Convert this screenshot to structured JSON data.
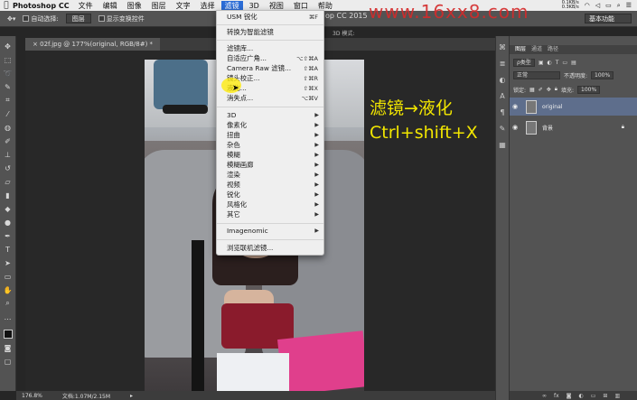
{
  "menubar": {
    "apple": "",
    "app": "Photoshop CC",
    "items": [
      "文件",
      "编辑",
      "图像",
      "图层",
      "文字",
      "选择",
      "滤镜",
      "3D",
      "视图",
      "窗口",
      "帮助"
    ],
    "active_index": 6,
    "net_up": "0.1KB/s",
    "net_down": "0.3KB/s"
  },
  "watermark": "www.16xx8.com",
  "title_fragment": "op CC 2015",
  "optbar": {
    "auto_select": "自动选择:",
    "auto_select_value": "图层",
    "show_transform": "显示变换控件",
    "mode_3d": "3D 模式:",
    "workspace": "基本功能"
  },
  "document": {
    "tab_title": "02f.jpg @ 177%(original, RGB/8#) *"
  },
  "status": {
    "zoom": "176.8%",
    "doc_size": "文档:1.07M/2.15M"
  },
  "filter_menu": {
    "items": [
      {
        "label": "USM 锐化",
        "shortcut": "⌘F"
      },
      {
        "label": "转换为智能滤镜",
        "shortcut": ""
      },
      {
        "label": "滤镜库...",
        "shortcut": ""
      },
      {
        "label": "自适应广角...",
        "shortcut": "⌥⇧⌘A"
      },
      {
        "label": "Camera Raw 滤镜...",
        "shortcut": "⇧⌘A"
      },
      {
        "label": "镜头校正...",
        "shortcut": "⇧⌘R"
      },
      {
        "label": "液化...",
        "shortcut": "⇧⌘X"
      },
      {
        "label": "消失点...",
        "shortcut": "⌥⌘V"
      },
      {
        "label": "3D",
        "shortcut": ""
      },
      {
        "label": "像素化",
        "shortcut": ""
      },
      {
        "label": "扭曲",
        "shortcut": ""
      },
      {
        "label": "杂色",
        "shortcut": ""
      },
      {
        "label": "模糊",
        "shortcut": ""
      },
      {
        "label": "模糊画廊",
        "shortcut": ""
      },
      {
        "label": "渲染",
        "shortcut": ""
      },
      {
        "label": "视频",
        "shortcut": ""
      },
      {
        "label": "锐化",
        "shortcut": ""
      },
      {
        "label": "风格化",
        "shortcut": ""
      },
      {
        "label": "其它",
        "shortcut": ""
      },
      {
        "label": "Imagenomic",
        "shortcut": ""
      },
      {
        "label": "浏览联机滤镜...",
        "shortcut": ""
      }
    ]
  },
  "annotation": {
    "line1": "滤镜→液化",
    "line2": "Ctrl+shift+X"
  },
  "layers_panel": {
    "tabs": [
      "图层",
      "通道",
      "路径"
    ],
    "filter_kind": "ρ类型",
    "blend_mode": "正常",
    "opacity_label": "不透明度:",
    "opacity_value": "100%",
    "lock_label": "锁定:",
    "fill_label": "填充:",
    "fill_value": "100%",
    "layers": [
      {
        "name": "original",
        "selected": true
      },
      {
        "name": "背景",
        "selected": false
      }
    ]
  }
}
